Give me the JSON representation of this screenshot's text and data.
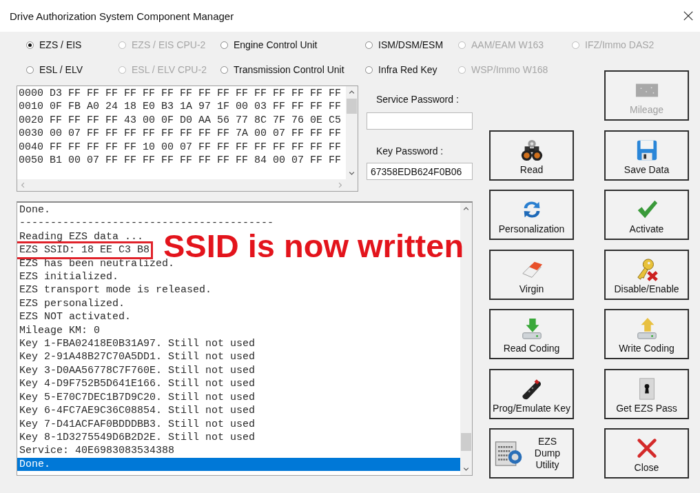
{
  "window": {
    "title": "Drive Authorization System Component Manager"
  },
  "radio_rows": [
    {
      "options": [
        {
          "label": "EZS / EIS",
          "selected": true,
          "disabled": false
        },
        {
          "label": "EZS / EIS CPU-2",
          "selected": false,
          "disabled": true
        },
        {
          "label": "Engine Control Unit",
          "selected": false,
          "disabled": false
        },
        {
          "label": "ISM/DSM/ESM",
          "selected": false,
          "disabled": false
        },
        {
          "label": "AAM/EAM W163",
          "selected": false,
          "disabled": true
        },
        {
          "label": "IFZ/Immo DAS2",
          "selected": false,
          "disabled": true
        }
      ]
    },
    {
      "options": [
        {
          "label": "ESL / ELV",
          "selected": false,
          "disabled": false
        },
        {
          "label": "ESL / ELV CPU-2",
          "selected": false,
          "disabled": true
        },
        {
          "label": "Transmission Control Unit",
          "selected": false,
          "disabled": false
        },
        {
          "label": "Infra Red Key",
          "selected": false,
          "disabled": false
        },
        {
          "label": "WSP/Immo W168",
          "selected": false,
          "disabled": true
        }
      ]
    }
  ],
  "hex_view": {
    "lines": [
      "0000 D3 FF FF FF FF FF FF FF FF FF FF FF FF FF FF FF",
      "0010 0F FB A0 24 18 E0 B3 1A 97 1F 00 03 FF FF FF FF",
      "0020 FF FF FF FF 43 00 0F D0 AA 56 77 8C 7F 76 0E C5",
      "0030 00 07 FF FF FF FF FF FF FF FF 7A 00 07 FF FF FF",
      "0040 FF FF FF FF FF 10 00 07 FF FF FF FF FF FF FF FF",
      "0050 B1 00 07 FF FF FF FF FF FF FF FF 84 00 07 FF FF"
    ]
  },
  "service_password": {
    "label": "Service Password :"
  },
  "key_password": {
    "label": "Key Password :",
    "value": "67358EDB624F0B06"
  },
  "log": {
    "lines": [
      {
        "text": "Done.",
        "selected": false,
        "boxed": false
      },
      {
        "text": "-----------------------------------------",
        "selected": false,
        "boxed": false
      },
      {
        "text": "Reading EZS data ...",
        "selected": false,
        "boxed": false
      },
      {
        "text": "EZS SSID: 18 EE C3 B8",
        "selected": false,
        "boxed": true
      },
      {
        "text": "EZS has been neutralized.",
        "selected": false,
        "boxed": false
      },
      {
        "text": "EZS initialized.",
        "selected": false,
        "boxed": false
      },
      {
        "text": "EZS transport mode is released.",
        "selected": false,
        "boxed": false
      },
      {
        "text": "EZS personalized.",
        "selected": false,
        "boxed": false
      },
      {
        "text": "EZS NOT activated.",
        "selected": false,
        "boxed": false
      },
      {
        "text": "Mileage KM: 0",
        "selected": false,
        "boxed": false
      },
      {
        "text": "Key 1-FBA02418E0B31A97. Still not used",
        "selected": false,
        "boxed": false
      },
      {
        "text": "Key 2-91A48B27C70A5DD1. Still not used",
        "selected": false,
        "boxed": false
      },
      {
        "text": "Key 3-D0AA56778C7F760E. Still not used",
        "selected": false,
        "boxed": false
      },
      {
        "text": "Key 4-D9F752B5D641E166. Still not used",
        "selected": false,
        "boxed": false
      },
      {
        "text": "Key 5-E70C7DEC1B7D9C20. Still not used",
        "selected": false,
        "boxed": false
      },
      {
        "text": "Key 6-4FC7AE9C36C08854. Still not used",
        "selected": false,
        "boxed": false
      },
      {
        "text": "Key 7-D41ACFAF0BDDDBB3. Still not used",
        "selected": false,
        "boxed": false
      },
      {
        "text": "Key 8-1D3275549D6B2D2E. Still not used",
        "selected": false,
        "boxed": false
      },
      {
        "text": "Service: 40E6983083534388",
        "selected": false,
        "boxed": false
      },
      {
        "text": "Done.",
        "selected": true,
        "boxed": false
      }
    ]
  },
  "annotation": {
    "text": "SSID is now written"
  },
  "buttons": [
    {
      "label": "Mileage",
      "kind": "stacked",
      "disabled": true
    },
    {
      "label": "Read",
      "kind": "stacked",
      "disabled": false
    },
    {
      "label": "Save Data",
      "kind": "stacked",
      "disabled": false
    },
    {
      "label": "Personalization",
      "kind": "stacked",
      "disabled": false
    },
    {
      "label": "Activate",
      "kind": "stacked",
      "disabled": false
    },
    {
      "label": "Virgin",
      "kind": "stacked",
      "disabled": false
    },
    {
      "label": "Disable/Enable",
      "kind": "stacked",
      "disabled": false
    },
    {
      "label": "Read Coding",
      "kind": "stacked",
      "disabled": false
    },
    {
      "label": "Write Coding",
      "kind": "stacked",
      "disabled": false
    },
    {
      "label": "Prog/Emulate Key",
      "kind": "stacked",
      "disabled": false
    },
    {
      "label": "Get EZS Pass",
      "kind": "stacked",
      "disabled": false
    },
    {
      "label": "EZS Dump Utility",
      "kind": "side",
      "disabled": false
    },
    {
      "label": "Close",
      "kind": "stacked",
      "disabled": false
    }
  ]
}
